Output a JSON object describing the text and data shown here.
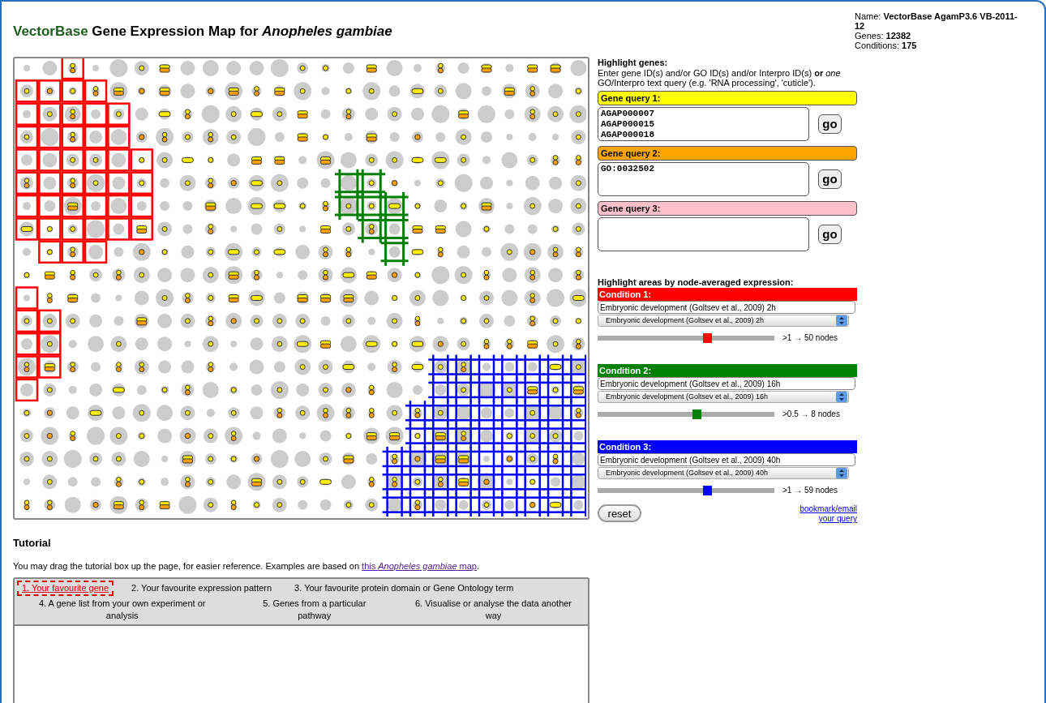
{
  "header": {
    "brand": "VectorBase",
    "title": "Gene Expression Map for *Anopheles gambiae*"
  },
  "map_info": [
    {
      "label": "Name:",
      "value": "VectorBase AgamP3.6 VB-2011-12"
    },
    {
      "label": "Genes:",
      "value": "12382"
    },
    {
      "label": "Conditions:",
      "value": "175"
    }
  ],
  "highlight_genes": {
    "heading": "Highlight genes:",
    "instructions": "Enter gene ID(s) and/or GO ID(s) and/or Interpro ID(s) **or** *one* GO/Interpro text query (e.g. 'RNA processing', 'cuticle').",
    "queries": [
      {
        "label": "Gene query 1:",
        "color": "#ffff00",
        "value": "AGAP000007\nAGAP000015\nAGAP000018",
        "button": "go"
      },
      {
        "label": "Gene query 2:",
        "color": "#ffa500",
        "value": "GO:0032502",
        "button": "go"
      },
      {
        "label": "Gene query 3:",
        "color": "#ffc0cb",
        "button": "go"
      }
    ]
  },
  "highlight_areas": {
    "heading": "Highlight areas by node-averaged expression:",
    "conditions": [
      {
        "label": "Condition 1:",
        "color": "#ff0000",
        "field": "Embryonic development (Goltsev et al., 2009) 2h",
        "select": "Embryonic development (Goltsev et al., 2009) 2h",
        "level": 0.62,
        "reading": ">1 → 50 nodes"
      },
      {
        "label": "Condition 2:",
        "color": "#008000",
        "field": "Embryonic development (Goltsev et al., 2009) 16h",
        "select": "Embryonic development (Goltsev et al., 2009) 16h",
        "level": 0.56,
        "reading": ">0.5 → 8 nodes"
      },
      {
        "label": "Condition 3:",
        "color": "#0000ff",
        "field": "Embryonic development (Goltsev et al., 2009) 40h",
        "select": "Embryonic development (Goltsev et al., 2009) 40h",
        "level": 0.62,
        "reading": ">1 → 59 nodes"
      }
    ],
    "reset": "reset",
    "link": "bookmark/email your query"
  },
  "tutorial": {
    "heading": "Tutorial",
    "intro": "You may drag the tutorial box up the page, for easier reference. Examples are based on ",
    "link": "this *Anopheles gambiae* map",
    "after_link": ".",
    "tab_rows": [
      [
        {
          "label": "1. Your favourite gene",
          "selected": true
        },
        {
          "label": "2. Your favourite expression pattern",
          "selected": false
        },
        {
          "label": "3. Your favourite protein domain or Gene Ontology term",
          "selected": false
        }
      ],
      [
        {
          "label": "4. A gene list from your own experiment or analysis",
          "selected": false
        },
        {
          "label": "5. Genes from a particular pathway",
          "selected": false
        },
        {
          "label": "6. Visualise or analyse the data another way",
          "selected": false
        }
      ]
    ]
  }
}
